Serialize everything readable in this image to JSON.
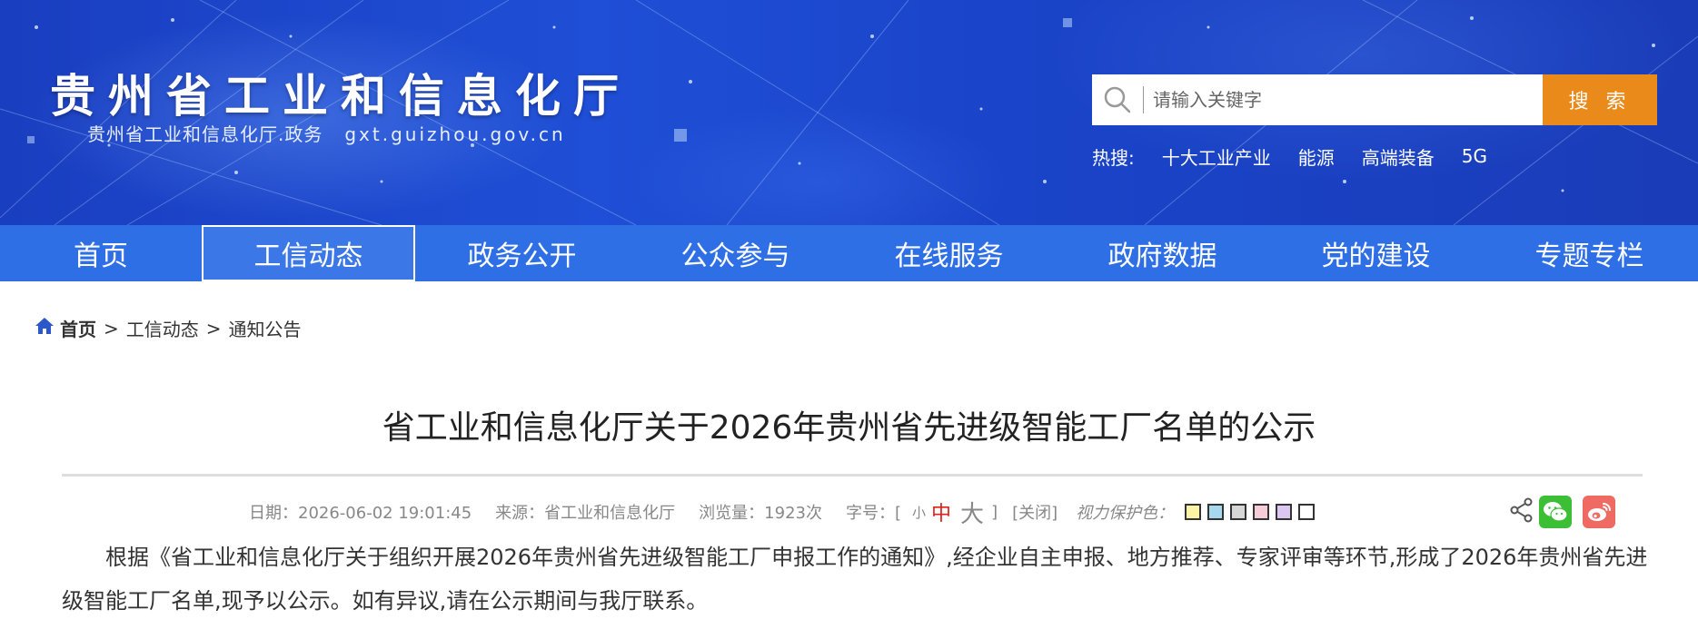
{
  "header": {
    "site_title": "贵州省工业和信息化厅",
    "site_subtitle": "贵州省工业和信息化厅.政务",
    "site_domain": "gxt.guizhou.gov.cn"
  },
  "search": {
    "placeholder": "请输入关键字",
    "button_label": "搜 索",
    "hot_label": "热搜:",
    "hot_terms": [
      "十大工业产业",
      "能源",
      "高端装备",
      "5G"
    ]
  },
  "nav": {
    "items": [
      "首页",
      "工信动态",
      "政务公开",
      "公众参与",
      "在线服务",
      "政府数据",
      "党的建设",
      "专题专栏"
    ],
    "active_index": 1
  },
  "breadcrumb": {
    "home": "首页",
    "sep": ">",
    "items": [
      "工信动态",
      "通知公告"
    ]
  },
  "article": {
    "title": "省工业和信息化厅关于2026年贵州省先进级智能工厂名单的公示",
    "date": "日期：2026-06-02 19:01:45",
    "source": "来源：省工业和信息化厅",
    "views": "浏览量：1923次",
    "font_size_label": "字号：[",
    "font_small": "小",
    "font_mid": "中",
    "font_big": "大",
    "font_close_bracket": "]",
    "close_label": "[关闭]",
    "vision_label": "视力保护色：",
    "vision_colors": [
      "#fdf5a6",
      "#a6d8ee",
      "#d6d6d6",
      "#f6ccd8",
      "#dcc6f2",
      "#ffffff"
    ],
    "body": "根据《省工业和信息化厅关于组织开展2026年贵州省先进级智能工厂申报工作的通知》,经企业自主申报、地方推荐、专家评审等环节,形成了2026年贵州省先进级智能工厂名单,现予以公示。如有异议,请在公示期间与我厅联系。"
  },
  "colors": {
    "header_blue": "#1f4fd6",
    "nav_blue": "#2f6fe6",
    "search_button": "#e98a1a",
    "accent_red": "#e0201b",
    "wechat_green": "#3cbf35",
    "weibo_red": "#ef6a63"
  },
  "icons": {
    "search": "search-icon",
    "home": "home-icon",
    "share": "share-icon",
    "wechat": "wechat-icon",
    "weibo": "weibo-icon"
  }
}
